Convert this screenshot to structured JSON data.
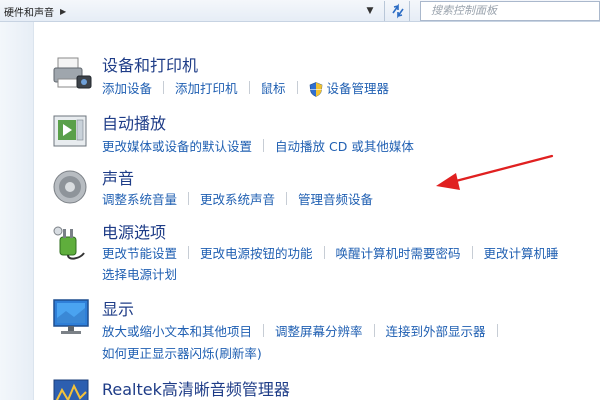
{
  "address_bar": {
    "breadcrumb_current": "硬件和声音",
    "search_placeholder": "搜索控制面板"
  },
  "categories": [
    {
      "title": "设备和打印机",
      "icon": "printer-icon",
      "links": [
        "添加设备",
        "添加打印机",
        "鼠标",
        "设备管理器"
      ]
    },
    {
      "title": "自动播放",
      "icon": "autoplay-icon",
      "links": [
        "更改媒体或设备的默认设置",
        "自动播放 CD 或其他媒体"
      ]
    },
    {
      "title": "声音",
      "icon": "speaker-icon",
      "links": [
        "调整系统音量",
        "更改系统声音",
        "管理音频设备"
      ]
    },
    {
      "title": "电源选项",
      "icon": "power-plug-icon",
      "links": [
        "更改节能设置",
        "更改电源按钮的功能",
        "唤醒计算机时需要密码",
        "更改计算机睡"
      ],
      "links_row2": [
        "选择电源计划"
      ]
    },
    {
      "title": "显示",
      "icon": "monitor-icon",
      "links": [
        "放大或缩小文本和其他项目",
        "调整屏幕分辨率",
        "连接到外部显示器"
      ],
      "links_row2": [
        "如何更正显示器闪烁(刷新率)"
      ]
    },
    {
      "title": "Realtek高清晰音频管理器",
      "icon": "realtek-audio-icon",
      "links": []
    }
  ],
  "colors": {
    "title": "#1e3c87",
    "link": "#1f5fb2",
    "annotation_arrow": "#e02020"
  }
}
